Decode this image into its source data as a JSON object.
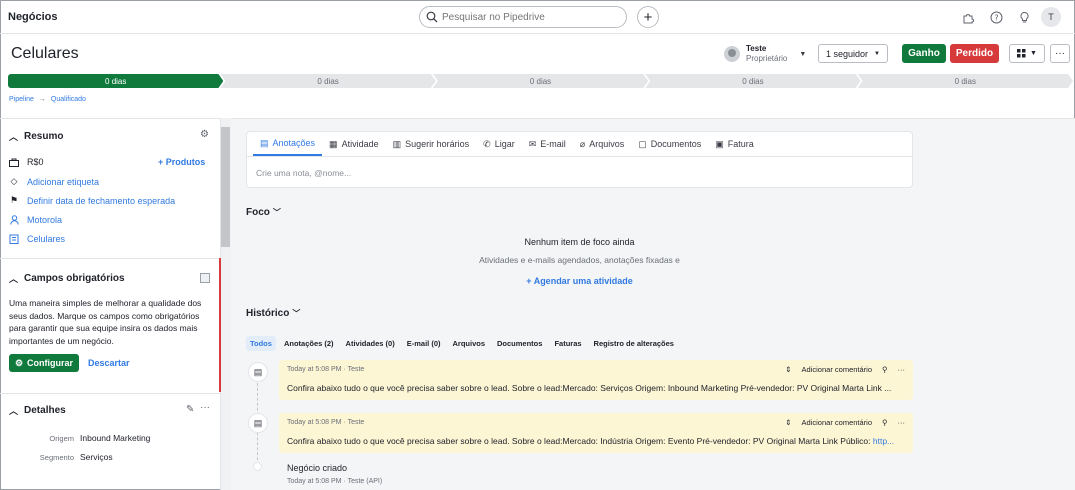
{
  "topbar": {
    "title": "Negócios",
    "search_placeholder": "Pesquisar no Pipedrive",
    "add_label": "+",
    "user_initial": "T"
  },
  "header": {
    "deal_title": "Celulares",
    "owner_name": "Teste",
    "owner_role": "Proprietário",
    "follow_label": "1 seguidor",
    "won_label": "Ganho",
    "lost_label": "Perdido",
    "more_label": "···"
  },
  "stages": [
    {
      "label": "0 dias",
      "active": true
    },
    {
      "label": "0 dias",
      "active": false
    },
    {
      "label": "0 dias",
      "active": false
    },
    {
      "label": "0 dias",
      "active": false
    },
    {
      "label": "0 dias",
      "active": false
    }
  ],
  "breadcrumb": {
    "pipeline": "Pipeline",
    "sep": "→",
    "stage": "Qualificado"
  },
  "summary": {
    "title": "Resumo",
    "value": "R$0",
    "add_products": "+ Produtos",
    "add_tag": "Adicionar etiqueta",
    "set_close_date": "Definir data de fechamento esperada",
    "person": "Motorola",
    "org": "Celulares"
  },
  "required": {
    "title": "Campos obrigatórios",
    "text": "Uma maneira simples de melhorar a qualidade dos seus dados. Marque os campos como obrigatórios para garantir que sua equipe insira os dados mais importantes de um negócio.",
    "configure": "Configurar",
    "dismiss": "Descartar"
  },
  "details": {
    "title": "Detalhes",
    "rows": [
      {
        "label": "Origem",
        "value": "Inbound Marketing"
      },
      {
        "label": "Segmento",
        "value": "Serviços"
      }
    ]
  },
  "composer": {
    "tabs": [
      {
        "label": "Anotações",
        "icon": "note-icon"
      },
      {
        "label": "Atividade",
        "icon": "calendar-icon"
      },
      {
        "label": "Sugerir horários",
        "icon": "calendar-clock-icon"
      },
      {
        "label": "Ligar",
        "icon": "phone-icon"
      },
      {
        "label": "E-mail",
        "icon": "mail-icon"
      },
      {
        "label": "Arquivos",
        "icon": "paperclip-icon"
      },
      {
        "label": "Documentos",
        "icon": "document-icon"
      },
      {
        "label": "Fatura",
        "icon": "invoice-icon"
      }
    ],
    "placeholder": "Crie uma nota, @nome..."
  },
  "focus": {
    "title": "Foco",
    "empty_title": "Nenhum item de foco ainda",
    "empty_sub": "Atividades e e-mails agendados, anotações fixadas e",
    "schedule": "+ Agendar uma atividade"
  },
  "history": {
    "title": "Histórico",
    "filters": [
      "Todos",
      "Anotações (2)",
      "Atividades (0)",
      "E-mail (0)",
      "Arquivos",
      "Documentos",
      "Faturas",
      "Registro de alterações"
    ],
    "notes": [
      {
        "meta": "Today at 5:08 PM · Teste",
        "add_comment": "Adicionar comentário",
        "body": "Confira abaixo tudo o que você precisa saber sobre o lead. Sobre o lead:Mercado: Serviços Origem: Inbound Marketing Pré-vendedor: PV Original Marta Link ..."
      },
      {
        "meta": "Today at 5:08 PM · Teste",
        "add_comment": "Adicionar comentário",
        "body": "Confira abaixo tudo o que você precisa saber sobre o lead. Sobre o lead:Mercado: Indústria Origem: Evento Pré-vendedor: PV Original Marta Link Público: ",
        "link": "http..."
      }
    ],
    "created_title": "Negócio criado",
    "created_meta": "Today at 5:08 PM · Teste (API)"
  },
  "colors": {
    "accent": "#317ae2",
    "won": "#107a3c",
    "lost": "#d73a3a",
    "note_bg": "#fdf6d4"
  }
}
